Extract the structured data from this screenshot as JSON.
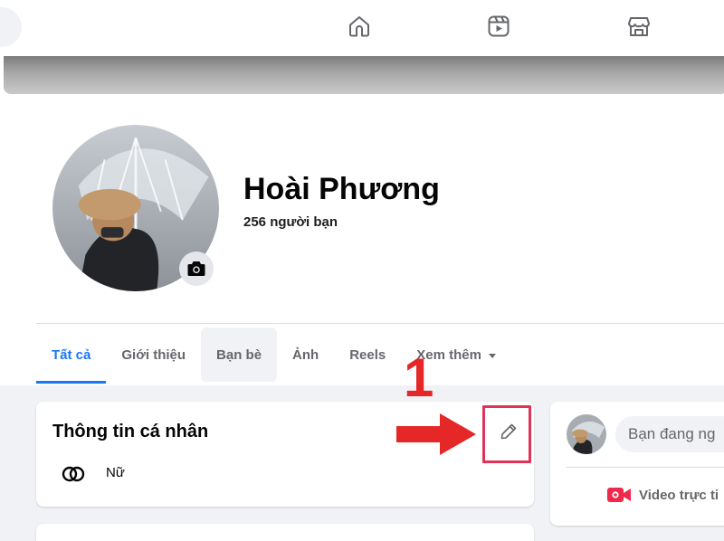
{
  "colors": {
    "accent": "#1877f2",
    "annotation_red": "#e52727",
    "highlight_border": "#e0335a",
    "video_red": "#f02849",
    "page_bg": "#f0f2f5"
  },
  "topnav": {
    "icons": [
      "home-icon",
      "watch-icon",
      "marketplace-icon"
    ]
  },
  "profile": {
    "name": "Hoài Phương",
    "friends": "256 người bạn"
  },
  "tabs": [
    {
      "label": "Tất cả",
      "active": true
    },
    {
      "label": "Giới thiệu"
    },
    {
      "label": "Bạn bè"
    },
    {
      "label": "Ảnh"
    },
    {
      "label": "Reels"
    },
    {
      "label": "Xem thêm"
    }
  ],
  "intro": {
    "title": "Thông tin cá nhân",
    "gender": "Nữ"
  },
  "composer": {
    "placeholder": "Bạn đang ng",
    "video_label": "Video trực ti"
  },
  "annotation": {
    "step": "1"
  }
}
